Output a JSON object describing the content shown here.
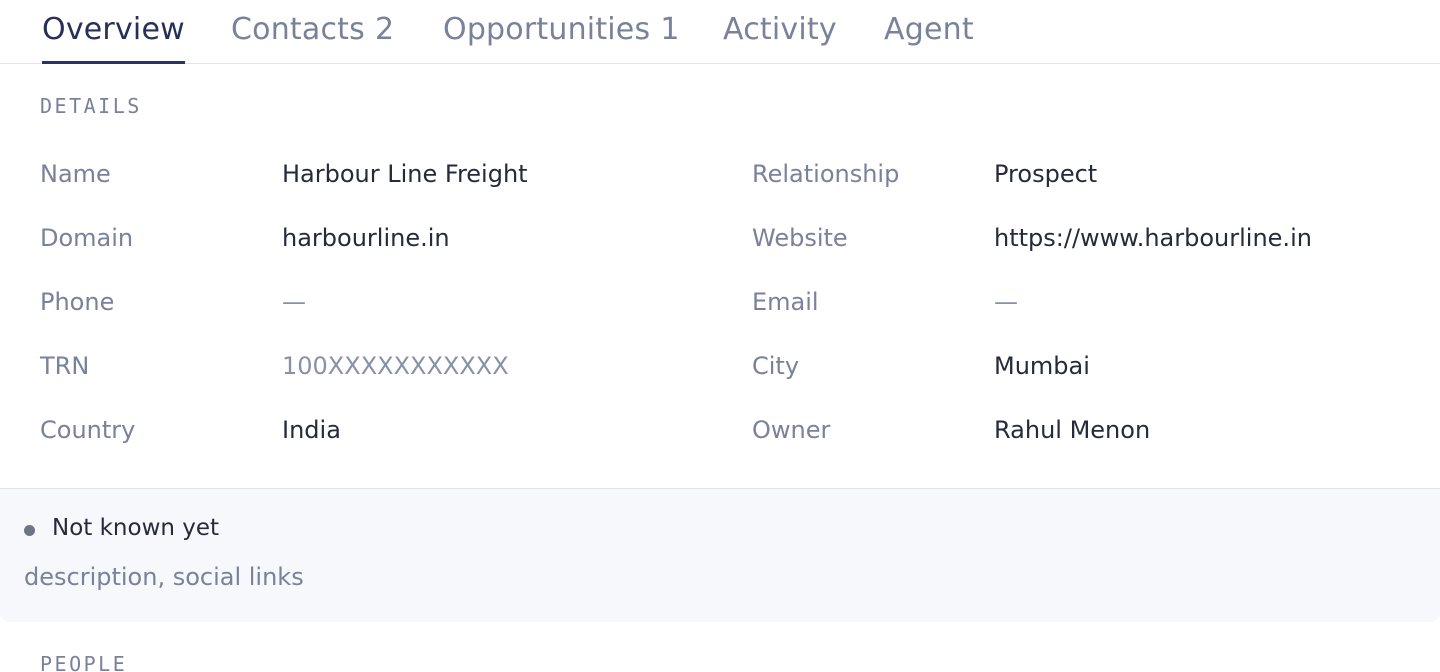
{
  "tabs": {
    "overview": {
      "label": "Overview"
    },
    "contacts": {
      "label": "Contacts",
      "count": "2"
    },
    "opportunities": {
      "label": "Opportunities",
      "count": "1"
    },
    "activity": {
      "label": "Activity"
    },
    "agent": {
      "label": "Agent"
    }
  },
  "details": {
    "heading": "DETAILS",
    "name": {
      "label": "Name",
      "value": "Harbour Line Freight"
    },
    "relationship": {
      "label": "Relationship",
      "value": "Prospect"
    },
    "domain": {
      "label": "Domain",
      "value": "harbourline.in"
    },
    "website": {
      "label": "Website",
      "value": "https://www.harbourline.in"
    },
    "phone": {
      "label": "Phone",
      "value": "—"
    },
    "email": {
      "label": "Email",
      "value": "—"
    },
    "trn": {
      "label": "TRN",
      "value": "100XXXXXXXXXXX"
    },
    "city": {
      "label": "City",
      "value": "Mumbai"
    },
    "country": {
      "label": "Country",
      "value": "India"
    },
    "owner": {
      "label": "Owner",
      "value": "Rahul Menon"
    }
  },
  "callout": {
    "title": "Not known yet",
    "description": "description, social links"
  },
  "people": {
    "heading": "PEOPLE"
  }
}
